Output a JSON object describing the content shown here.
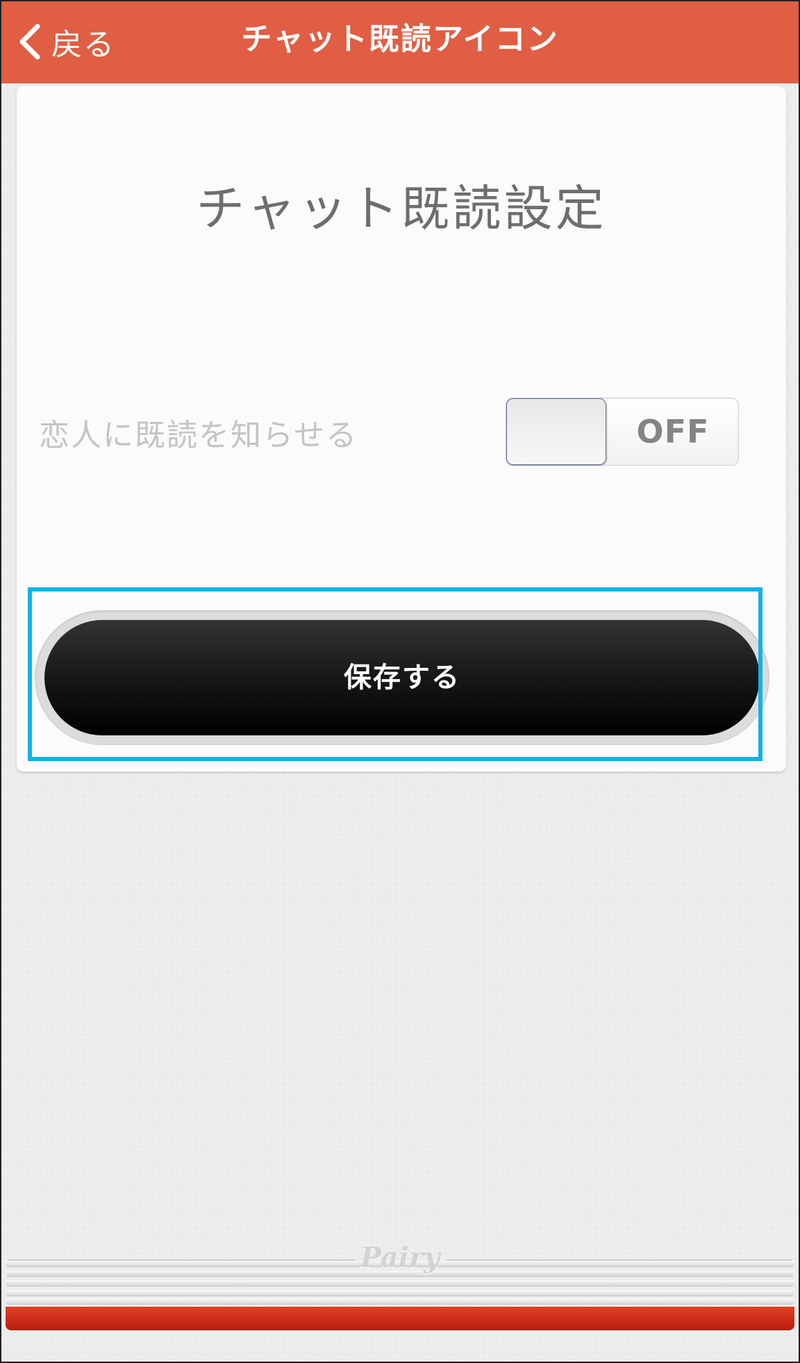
{
  "header": {
    "back_label": "戻る",
    "title": "チャット既読アイコン"
  },
  "card": {
    "title": "チャット既読設定",
    "setting_label": "恋人に既読を知らせる",
    "toggle_state_label": "OFF",
    "toggle_on": false
  },
  "save_button": {
    "label": "保存する"
  },
  "footer": {
    "brand": "Pairy"
  },
  "colors": {
    "header_bg": "#e05e43",
    "highlight": "#10b2ec",
    "footer_red": "#c62a16"
  },
  "icons": {
    "back": "chevron-left-icon"
  }
}
